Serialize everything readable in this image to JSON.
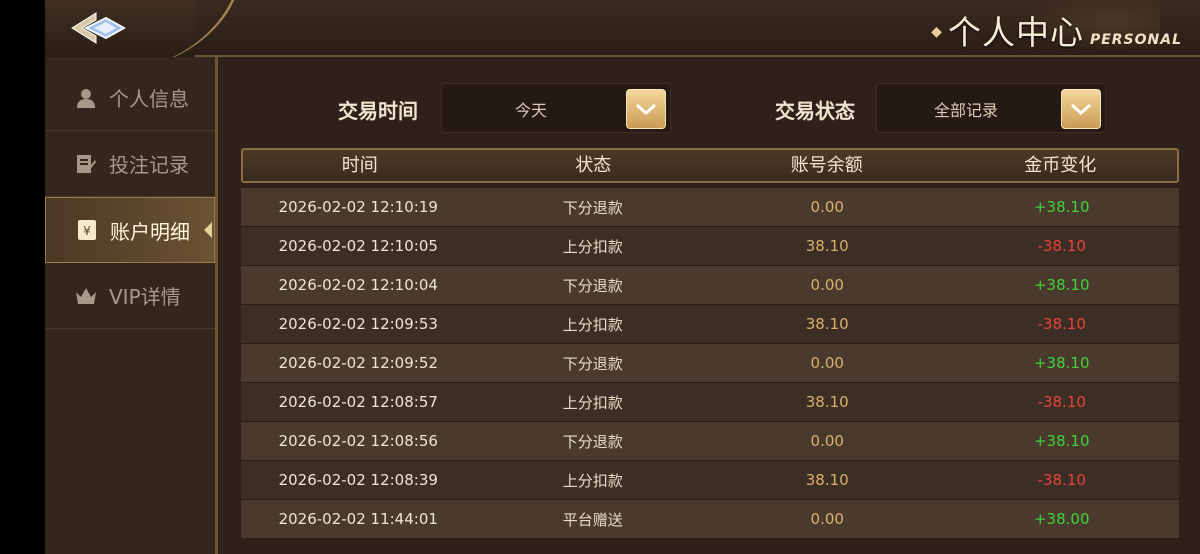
{
  "header": {
    "title_cn": "个人中心",
    "title_en": "PERSONAL",
    "back_icon": "back-diamond-icon"
  },
  "sidebar": {
    "items": [
      {
        "label": "个人信息",
        "icon": "user-icon",
        "active": false
      },
      {
        "label": "投注记录",
        "icon": "edit-document-icon",
        "active": false
      },
      {
        "label": "账户明细",
        "icon": "yen-document-icon",
        "active": true
      },
      {
        "label": "VIP详情",
        "icon": "crown-icon",
        "active": false
      }
    ]
  },
  "filters": {
    "time_label": "交易时间",
    "time_value": "今天",
    "status_label": "交易状态",
    "status_value": "全部记录"
  },
  "table": {
    "headers": [
      "时间",
      "状态",
      "账号余额",
      "金币变化"
    ],
    "rows": [
      {
        "time": "2026-02-02 12:10:19",
        "status": "下分退款",
        "balance": "0.00",
        "change": "+38.10"
      },
      {
        "time": "2026-02-02 12:10:05",
        "status": "上分扣款",
        "balance": "38.10",
        "change": "-38.10"
      },
      {
        "time": "2026-02-02 12:10:04",
        "status": "下分退款",
        "balance": "0.00",
        "change": "+38.10"
      },
      {
        "time": "2026-02-02 12:09:53",
        "status": "上分扣款",
        "balance": "38.10",
        "change": "-38.10"
      },
      {
        "time": "2026-02-02 12:09:52",
        "status": "下分退款",
        "balance": "0.00",
        "change": "+38.10"
      },
      {
        "time": "2026-02-02 12:08:57",
        "status": "上分扣款",
        "balance": "38.10",
        "change": "-38.10"
      },
      {
        "time": "2026-02-02 12:08:56",
        "status": "下分退款",
        "balance": "0.00",
        "change": "+38.10"
      },
      {
        "time": "2026-02-02 12:08:39",
        "status": "上分扣款",
        "balance": "38.10",
        "change": "-38.10"
      },
      {
        "time": "2026-02-02 11:44:01",
        "status": "平台赠送",
        "balance": "0.00",
        "change": "+38.00"
      }
    ]
  },
  "colors": {
    "positive": "#3fd23a",
    "negative": "#e8433a",
    "accent_gold": "#d9b06c"
  }
}
